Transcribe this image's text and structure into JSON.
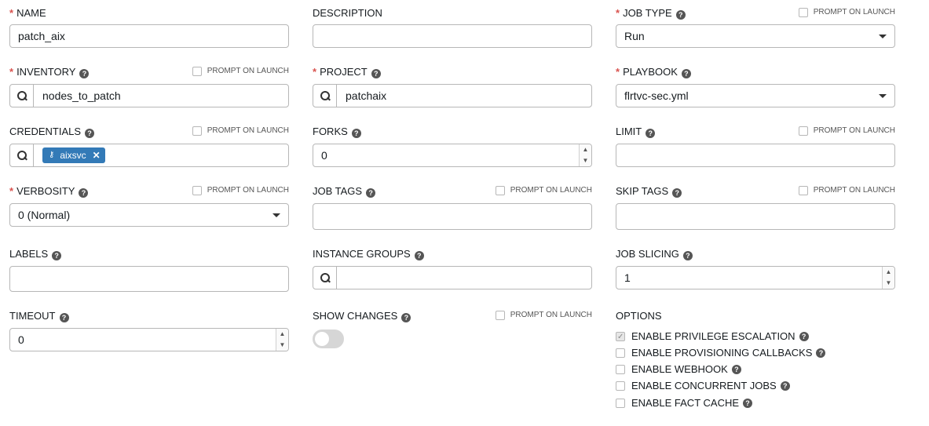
{
  "prompt_on_launch": "PROMPT ON LAUNCH",
  "help_glyph": "?",
  "fields": {
    "name": {
      "label": "NAME",
      "value": "patch_aix"
    },
    "description": {
      "label": "DESCRIPTION",
      "value": ""
    },
    "job_type": {
      "label": "JOB TYPE",
      "value": "Run"
    },
    "inventory": {
      "label": "INVENTORY",
      "value": "nodes_to_patch"
    },
    "project": {
      "label": "PROJECT",
      "value": "patchaix"
    },
    "playbook": {
      "label": "PLAYBOOK",
      "value": "flrtvc-sec.yml"
    },
    "credentials": {
      "label": "CREDENTIALS",
      "tag": "aixsvc"
    },
    "forks": {
      "label": "FORKS",
      "value": "0"
    },
    "limit": {
      "label": "LIMIT",
      "value": ""
    },
    "verbosity": {
      "label": "VERBOSITY",
      "value": "0 (Normal)"
    },
    "job_tags": {
      "label": "JOB TAGS",
      "value": ""
    },
    "skip_tags": {
      "label": "SKIP TAGS",
      "value": ""
    },
    "labels": {
      "label": "LABELS",
      "value": ""
    },
    "instance_groups": {
      "label": "INSTANCE GROUPS",
      "value": ""
    },
    "job_slicing": {
      "label": "JOB SLICING",
      "value": "1"
    },
    "timeout": {
      "label": "TIMEOUT",
      "value": "0"
    },
    "show_changes": {
      "label": "SHOW CHANGES",
      "enabled": false
    }
  },
  "options": {
    "label": "OPTIONS",
    "items": [
      {
        "label": "ENABLE PRIVILEGE ESCALATION",
        "checked": true
      },
      {
        "label": "ENABLE PROVISIONING CALLBACKS",
        "checked": false
      },
      {
        "label": "ENABLE WEBHOOK",
        "checked": false
      },
      {
        "label": "ENABLE CONCURRENT JOBS",
        "checked": false
      },
      {
        "label": "ENABLE FACT CACHE",
        "checked": false
      }
    ]
  }
}
